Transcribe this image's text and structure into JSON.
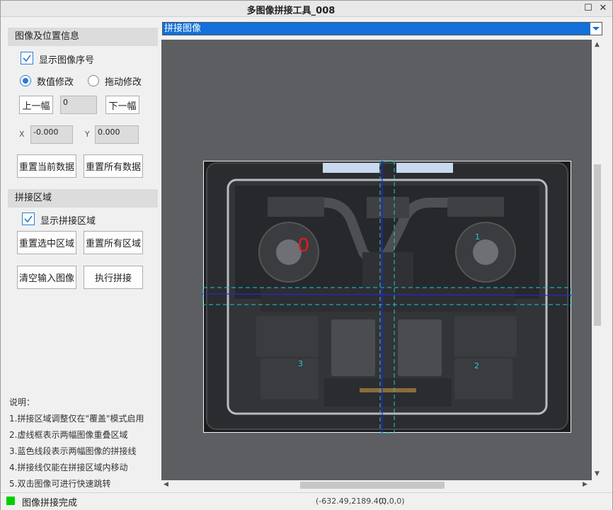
{
  "window": {
    "title": "多图像拼接工具_008"
  },
  "left_panel": {
    "section_image_position": "图像及位置信息",
    "show_index_label": "显示图像序号",
    "show_index_checked": true,
    "mode_numeric": "数值修改",
    "mode_drag": "拖动修改",
    "prev_button": "上一幅",
    "index_value": "0",
    "next_button": "下一幅",
    "x_label": "X",
    "x_value": "-0.000",
    "y_label": "Y",
    "y_value": "0.000",
    "reset_current": "重置当前数据",
    "reset_all_data": "重置所有数据",
    "section_region": "拼接区域",
    "show_region_label": "显示拼接区域",
    "show_region_checked": true,
    "reset_selected_region": "重置选中区域",
    "reset_all_regions": "重置所有区域",
    "clear_input": "清空输入图像",
    "execute": "执行拼接",
    "notes_title": "说明：",
    "notes": [
      "1.拼接区域调整仅在\"覆盖\"模式启用",
      "2.虚线框表示两幅图像重叠区域",
      "3.蓝色线段表示两幅图像的拼接线",
      "4.拼接线仅能在拼接区域内移动",
      "5.双击图像可进行快速跳转"
    ]
  },
  "combo": {
    "selected": "拼接图像"
  },
  "canvas": {
    "image_labels": [
      "0",
      "1",
      "2",
      "3"
    ]
  },
  "status": {
    "message": "图像拼接完成",
    "coords": "(-632.49,2189.40)",
    "pixel": "(0,0,0)"
  },
  "colors": {
    "accent": "#1170d9",
    "status_ok": "#00d000",
    "canvas_bg": "#5d5e62"
  }
}
